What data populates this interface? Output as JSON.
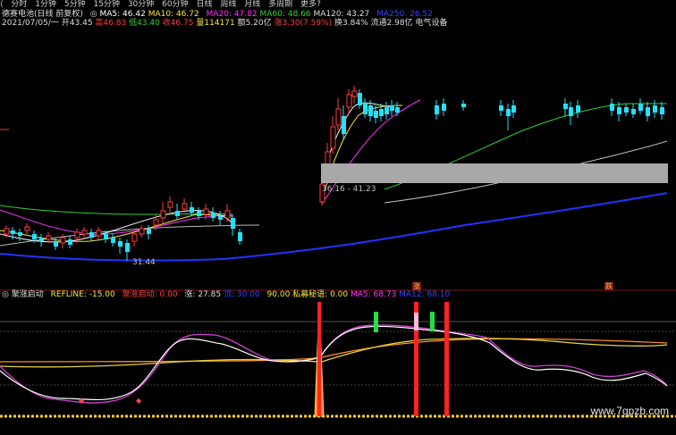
{
  "toolbar": {
    "back_icon": "back-arrow-icon",
    "periods": [
      "分时",
      "1分钟",
      "5分钟",
      "15分钟",
      "30分钟",
      "60分钟",
      "日线",
      "周线",
      "月线",
      "多周期",
      "更多"
    ],
    "more_icon": "chevron-down-icon"
  },
  "header": {
    "title": "德赛电池(日线 前复权)",
    "ma5": "MA5: 46.42",
    "ma10": "MA10: 46.72",
    "ma20": "MA20: 47.82",
    "ma60": "MA60: 48.66",
    "ma120": "MA120: 43.27",
    "ma250": "MA250: 26.52"
  },
  "stats": {
    "date": "2021/07/05/一",
    "open": "开43.45",
    "high": "高46.83",
    "low": "低43.40",
    "close": "收46.75",
    "volume": "量114171",
    "amount": "额5.20亿",
    "change": "涨3.30(7.59%)",
    "turnover": "换3.84%",
    "float_cap": "流通2.98亿",
    "sector": "电气设备"
  },
  "chart_labels": {
    "range": "36.16 - 41.23",
    "low": "31.44",
    "tag1": "涨",
    "tag2": "跌"
  },
  "indicator": {
    "name": "聚涨启动",
    "refline": "REFLINE: -15.00",
    "start": "聚涨启动: 0.00",
    "rise": "涨: 27.85",
    "blue_val": "顶: 30.00",
    "ninety": "90.00",
    "secret": "私募秘语: 0.00",
    "ma5": "MA5: 68.73",
    "ma12": "MA12: 68.10"
  },
  "colors": {
    "up": "#ff3b3b",
    "down": "#22e1ff",
    "ma5": "#ffffff",
    "ma10": "#f5e642",
    "ma20": "#ff33ff",
    "ma60": "#2fd02f",
    "ma120": "#bbbbbb",
    "ma250": "#2233ff",
    "signal_red": "#ff2222",
    "signal_green": "#22e042"
  },
  "watermark": "www.7gpzb.com"
}
